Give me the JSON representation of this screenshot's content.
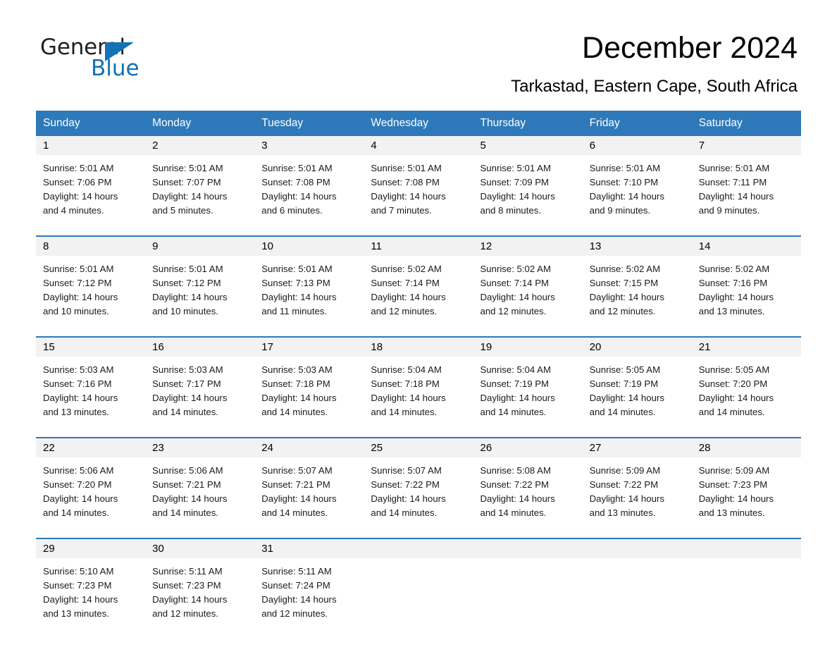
{
  "brand": {
    "name_part1": "General",
    "name_part2": "Blue",
    "logo_icon": "triangle-logo-icon",
    "accent_color": "#1272b5"
  },
  "header": {
    "month_title": "December 2024",
    "location": "Tarkastad, Eastern Cape, South Africa"
  },
  "calendar": {
    "header_background": "#2e79b9",
    "day_band_background": "#f2f2f2",
    "weekday_headers": [
      "Sunday",
      "Monday",
      "Tuesday",
      "Wednesday",
      "Thursday",
      "Friday",
      "Saturday"
    ],
    "weeks": [
      [
        {
          "day": "1",
          "lines": [
            "Sunrise: 5:01 AM",
            "Sunset: 7:06 PM",
            "Daylight: 14 hours",
            "and 4 minutes."
          ]
        },
        {
          "day": "2",
          "lines": [
            "Sunrise: 5:01 AM",
            "Sunset: 7:07 PM",
            "Daylight: 14 hours",
            "and 5 minutes."
          ]
        },
        {
          "day": "3",
          "lines": [
            "Sunrise: 5:01 AM",
            "Sunset: 7:08 PM",
            "Daylight: 14 hours",
            "and 6 minutes."
          ]
        },
        {
          "day": "4",
          "lines": [
            "Sunrise: 5:01 AM",
            "Sunset: 7:08 PM",
            "Daylight: 14 hours",
            "and 7 minutes."
          ]
        },
        {
          "day": "5",
          "lines": [
            "Sunrise: 5:01 AM",
            "Sunset: 7:09 PM",
            "Daylight: 14 hours",
            "and 8 minutes."
          ]
        },
        {
          "day": "6",
          "lines": [
            "Sunrise: 5:01 AM",
            "Sunset: 7:10 PM",
            "Daylight: 14 hours",
            "and 9 minutes."
          ]
        },
        {
          "day": "7",
          "lines": [
            "Sunrise: 5:01 AM",
            "Sunset: 7:11 PM",
            "Daylight: 14 hours",
            "and 9 minutes."
          ]
        }
      ],
      [
        {
          "day": "8",
          "lines": [
            "Sunrise: 5:01 AM",
            "Sunset: 7:12 PM",
            "Daylight: 14 hours",
            "and 10 minutes."
          ]
        },
        {
          "day": "9",
          "lines": [
            "Sunrise: 5:01 AM",
            "Sunset: 7:12 PM",
            "Daylight: 14 hours",
            "and 10 minutes."
          ]
        },
        {
          "day": "10",
          "lines": [
            "Sunrise: 5:01 AM",
            "Sunset: 7:13 PM",
            "Daylight: 14 hours",
            "and 11 minutes."
          ]
        },
        {
          "day": "11",
          "lines": [
            "Sunrise: 5:02 AM",
            "Sunset: 7:14 PM",
            "Daylight: 14 hours",
            "and 12 minutes."
          ]
        },
        {
          "day": "12",
          "lines": [
            "Sunrise: 5:02 AM",
            "Sunset: 7:14 PM",
            "Daylight: 14 hours",
            "and 12 minutes."
          ]
        },
        {
          "day": "13",
          "lines": [
            "Sunrise: 5:02 AM",
            "Sunset: 7:15 PM",
            "Daylight: 14 hours",
            "and 12 minutes."
          ]
        },
        {
          "day": "14",
          "lines": [
            "Sunrise: 5:02 AM",
            "Sunset: 7:16 PM",
            "Daylight: 14 hours",
            "and 13 minutes."
          ]
        }
      ],
      [
        {
          "day": "15",
          "lines": [
            "Sunrise: 5:03 AM",
            "Sunset: 7:16 PM",
            "Daylight: 14 hours",
            "and 13 minutes."
          ]
        },
        {
          "day": "16",
          "lines": [
            "Sunrise: 5:03 AM",
            "Sunset: 7:17 PM",
            "Daylight: 14 hours",
            "and 14 minutes."
          ]
        },
        {
          "day": "17",
          "lines": [
            "Sunrise: 5:03 AM",
            "Sunset: 7:18 PM",
            "Daylight: 14 hours",
            "and 14 minutes."
          ]
        },
        {
          "day": "18",
          "lines": [
            "Sunrise: 5:04 AM",
            "Sunset: 7:18 PM",
            "Daylight: 14 hours",
            "and 14 minutes."
          ]
        },
        {
          "day": "19",
          "lines": [
            "Sunrise: 5:04 AM",
            "Sunset: 7:19 PM",
            "Daylight: 14 hours",
            "and 14 minutes."
          ]
        },
        {
          "day": "20",
          "lines": [
            "Sunrise: 5:05 AM",
            "Sunset: 7:19 PM",
            "Daylight: 14 hours",
            "and 14 minutes."
          ]
        },
        {
          "day": "21",
          "lines": [
            "Sunrise: 5:05 AM",
            "Sunset: 7:20 PM",
            "Daylight: 14 hours",
            "and 14 minutes."
          ]
        }
      ],
      [
        {
          "day": "22",
          "lines": [
            "Sunrise: 5:06 AM",
            "Sunset: 7:20 PM",
            "Daylight: 14 hours",
            "and 14 minutes."
          ]
        },
        {
          "day": "23",
          "lines": [
            "Sunrise: 5:06 AM",
            "Sunset: 7:21 PM",
            "Daylight: 14 hours",
            "and 14 minutes."
          ]
        },
        {
          "day": "24",
          "lines": [
            "Sunrise: 5:07 AM",
            "Sunset: 7:21 PM",
            "Daylight: 14 hours",
            "and 14 minutes."
          ]
        },
        {
          "day": "25",
          "lines": [
            "Sunrise: 5:07 AM",
            "Sunset: 7:22 PM",
            "Daylight: 14 hours",
            "and 14 minutes."
          ]
        },
        {
          "day": "26",
          "lines": [
            "Sunrise: 5:08 AM",
            "Sunset: 7:22 PM",
            "Daylight: 14 hours",
            "and 14 minutes."
          ]
        },
        {
          "day": "27",
          "lines": [
            "Sunrise: 5:09 AM",
            "Sunset: 7:22 PM",
            "Daylight: 14 hours",
            "and 13 minutes."
          ]
        },
        {
          "day": "28",
          "lines": [
            "Sunrise: 5:09 AM",
            "Sunset: 7:23 PM",
            "Daylight: 14 hours",
            "and 13 minutes."
          ]
        }
      ],
      [
        {
          "day": "29",
          "lines": [
            "Sunrise: 5:10 AM",
            "Sunset: 7:23 PM",
            "Daylight: 14 hours",
            "and 13 minutes."
          ]
        },
        {
          "day": "30",
          "lines": [
            "Sunrise: 5:11 AM",
            "Sunset: 7:23 PM",
            "Daylight: 14 hours",
            "and 12 minutes."
          ]
        },
        {
          "day": "31",
          "lines": [
            "Sunrise: 5:11 AM",
            "Sunset: 7:24 PM",
            "Daylight: 14 hours",
            "and 12 minutes."
          ]
        },
        {
          "day": "",
          "lines": []
        },
        {
          "day": "",
          "lines": []
        },
        {
          "day": "",
          "lines": []
        },
        {
          "day": "",
          "lines": []
        }
      ]
    ]
  }
}
